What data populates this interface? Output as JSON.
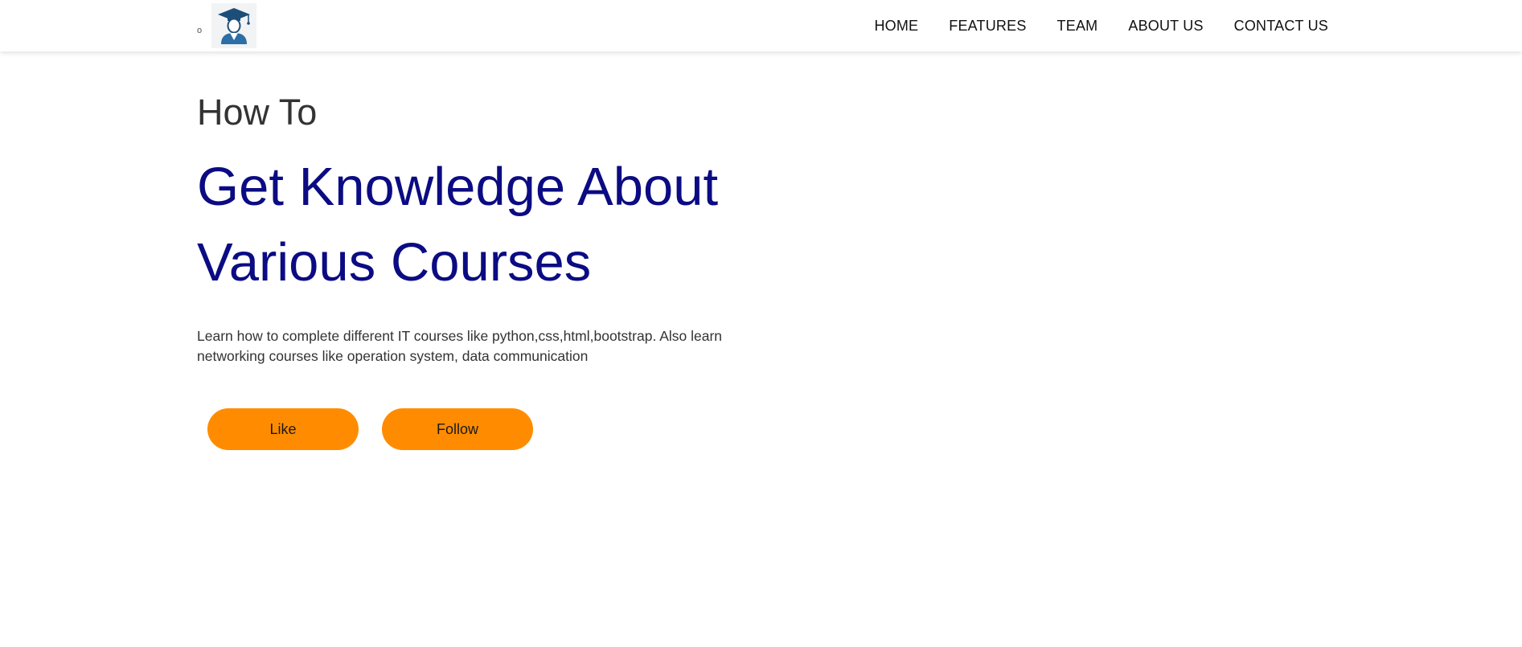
{
  "nav": {
    "brand_mark": "o",
    "logo_icon": "graduate-cap-icon",
    "links": [
      "HOME",
      "FEATURES",
      "TEAM",
      "ABOUT US",
      "CONTACT US"
    ]
  },
  "hero": {
    "eyebrow": "How To",
    "headline_line1": "Get Knowledge About",
    "headline_line2": "Various Courses",
    "description": "Learn how to complete different IT courses like python,css,html,bootstrap. Also learn networking courses like operation system, data communication"
  },
  "actions": {
    "like_label": "Like",
    "follow_label": "Follow"
  },
  "colors": {
    "accent": "#ff8c00",
    "headline": "#0b0b83",
    "text": "#333333"
  }
}
